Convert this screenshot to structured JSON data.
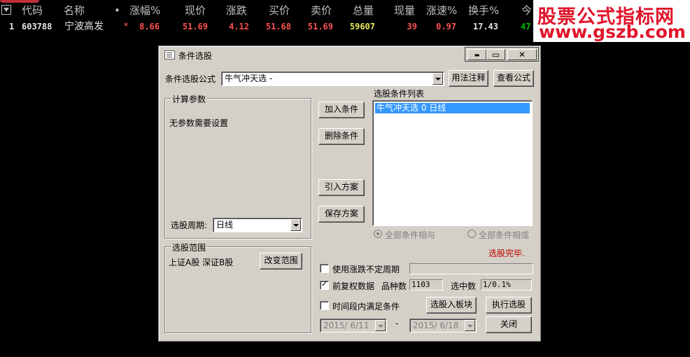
{
  "table": {
    "headers": {
      "code": "代码",
      "name": "名称",
      "dot": "•",
      "change_pct": "涨幅%",
      "price": "现价",
      "change": "涨跌",
      "bid": "买价",
      "ask": "卖价",
      "volume": "总量",
      "cur_vol": "现量",
      "speed": "涨速%",
      "turnover": "换手%",
      "today_partial": "今"
    },
    "rows": [
      {
        "index": "1",
        "code": "603788",
        "name": "宁波高发",
        "mark": "×",
        "change_pct": "8.66",
        "price": "51.69",
        "change": "4.12",
        "bid": "51.68",
        "ask": "51.69",
        "volume": "59607",
        "cur_vol": "39",
        "speed": "0.97",
        "turnover": "17.43",
        "today_partial": "47"
      }
    ]
  },
  "watermark": {
    "line1": "股票公式指标网",
    "line2": "www.gszb.com"
  },
  "dialog": {
    "title": "条件选股",
    "window_buttons": {
      "minimize": "▬",
      "maximize": "▭",
      "close": "✕"
    },
    "formula_label": "条件选股公式",
    "formula_value": "牛气冲天选 -",
    "usage_button": "用法注释",
    "view_formula_button": "查看公式",
    "calc_params": {
      "caption": "计算参数",
      "text": "无参数需要设置"
    },
    "period_label": "选股周期:",
    "period_value": "日线",
    "add_condition_button": "加入条件",
    "delete_condition_button": "删除条件",
    "import_plan_button": "引入方案",
    "save_plan_button": "保存方案",
    "list_label": "选股条件列表",
    "list_items": [
      "牛气冲天选  0  日线"
    ],
    "radio_and": "全部条件相与",
    "radio_or": "全部条件相或",
    "status": "选股完毕.",
    "range": {
      "caption": "选股范围",
      "text": "上证A股 深证B股",
      "change_button": "改变范围"
    },
    "use_uncertain_period": "使用涨跌不定周期",
    "adjusted_data": "前复权数据",
    "count_label": "品种数",
    "count_value": "1103",
    "selected_label": "选中数",
    "selected_value": "1/0.1%",
    "within_period": "时间段内满足条件",
    "to_block_button": "选股入板块",
    "execute_button": "执行选股",
    "close_button": "关闭",
    "date_from": "2015/ 6/11",
    "date_sep": "-",
    "date_to": "2015/ 6/18"
  },
  "colors": {
    "background": "#000000",
    "up_red": "#ff5050",
    "volume_yellow": "#e8e85a",
    "dialog_face": "#d4d0c8",
    "selection_blue": "#3399ff",
    "status_red": "#c00000"
  }
}
